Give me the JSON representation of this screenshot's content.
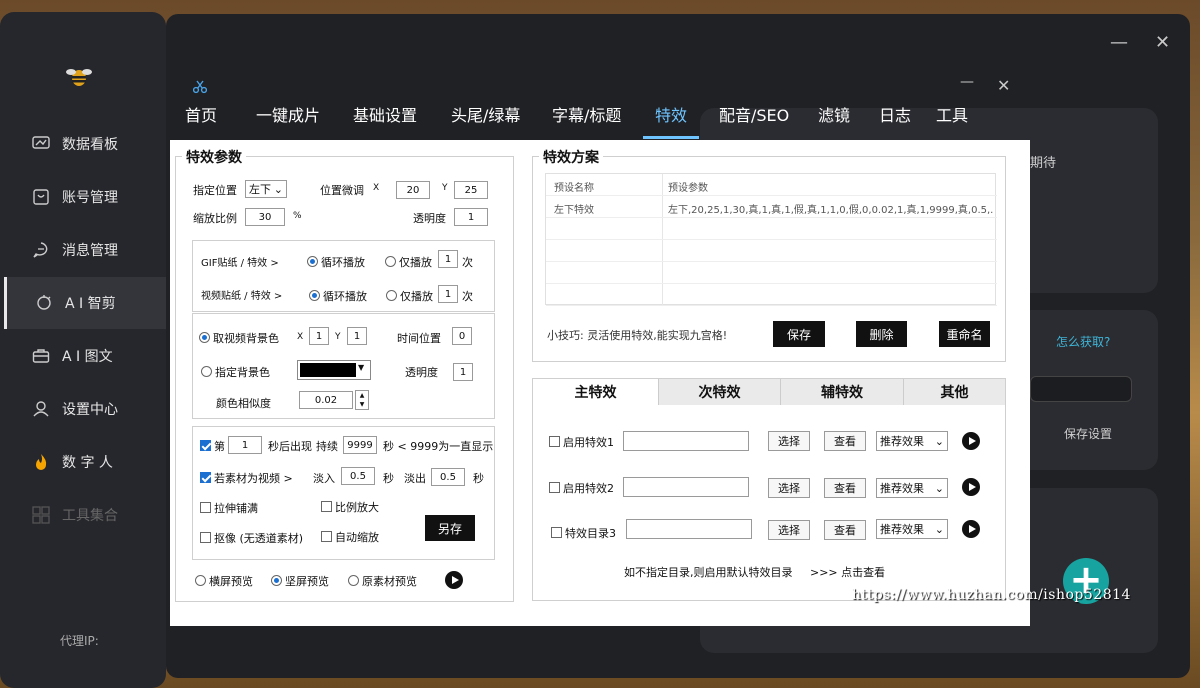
{
  "sidebar": {
    "items": [
      {
        "label": "数据看板",
        "icon": "dashboard-icon"
      },
      {
        "label": "账号管理",
        "icon": "account-icon"
      },
      {
        "label": "消息管理",
        "icon": "message-icon"
      },
      {
        "label": "A I 智剪",
        "icon": "ai-clip-icon"
      },
      {
        "label": "A I 图文",
        "icon": "briefcase-icon"
      },
      {
        "label": "设置中心",
        "icon": "settings-icon"
      },
      {
        "label": "数 字 人",
        "icon": "flame-icon"
      },
      {
        "label": "工具集合",
        "icon": "grid-icon"
      }
    ],
    "proxy_label": "代理IP:"
  },
  "background": {
    "wait_text": "期待",
    "how_get": "怎么获取?",
    "save_settings": "保存设置"
  },
  "watermark": "https://www.huzhan.com/ishop52814",
  "tabs": [
    "首页",
    "一键成片",
    "基础设置",
    "头尾/绿幕",
    "字幕/标题",
    "特效",
    "配音/SEO",
    "滤镜",
    "日志",
    "工具"
  ],
  "effect_params": {
    "title": "特效参数",
    "position_label": "指定位置",
    "position_value": "左下",
    "offset_label": "位置微调",
    "x_label": "X",
    "x_value": "20",
    "y_label": "Y",
    "y_value": "25",
    "scale_label": "缩放比例",
    "scale_value": "30",
    "percent": "%",
    "opacity_label": "透明度",
    "opacity_value": "1",
    "gif_label": "GIF贴纸 / 特效 >",
    "loop_label": "循环播放",
    "once_label": "仅播放",
    "gif_times": "1",
    "times_unit": "次",
    "video_label": "视频贴纸 / 特效 >",
    "video_times": "1",
    "take_bg_label": "取视频背景色",
    "bg_x": "1",
    "bg_y": "1",
    "time_pos_label": "时间位置",
    "time_pos_value": "0",
    "set_bg_label": "指定背景色",
    "bg_opacity_label": "透明度",
    "bg_opacity_value": "1",
    "similarity_label": "颜色相似度",
    "similarity_value": "0.02",
    "nth_label": "第",
    "nth_value": "1",
    "appear_label": "秒后出现",
    "duration_label": "持续",
    "duration_value": "9999",
    "duration_hint": "秒 < 9999为一直显示",
    "as_video_label": "若素材为视频 >",
    "fade_in_label": "淡入",
    "fade_in_value": "0.5",
    "sec": "秒",
    "fade_out_label": "淡出",
    "fade_out_value": "0.5",
    "stretch_label": "拉伸铺满",
    "ratio_label": "比例放大",
    "cutout_label": "抠像 (无透道素材)",
    "auto_scale_label": "自动缩放",
    "save_as": "另存",
    "landscape_label": "横屏预览",
    "portrait_label": "坚屏预览",
    "original_label": "原素材预览"
  },
  "effect_scheme": {
    "title": "特效方案",
    "col_name": "预设名称",
    "col_params": "预设参数",
    "rows": [
      {
        "name": "左下特效",
        "params": "左下,20,25,1,30,真,1,真,1,假,真,1,1,0,假,0,0.02,1,真,1,9999,真,0.5,..."
      }
    ],
    "tip": "小技巧: 灵活使用特效,能实现九宫格!",
    "save": "保存",
    "delete": "删除",
    "rename": "重命名"
  },
  "effect_tabs": [
    "主特效",
    "次特效",
    "辅特效",
    "其他"
  ],
  "effect_rows": [
    {
      "label": "启用特效1",
      "select": "选择",
      "view": "查看",
      "dropdown": "推荐效果"
    },
    {
      "label": "启用特效2",
      "select": "选择",
      "view": "查看",
      "dropdown": "推荐效果"
    },
    {
      "label": "特效目录3",
      "select": "选择",
      "view": "查看",
      "dropdown": "推荐效果"
    }
  ],
  "dir_hint": "如不指定目录,则启用默认特效目录",
  "dir_link": ">>> 点击查看",
  "colors": {
    "accent": "#6ec4ff",
    "panel": "#ffffff",
    "dark": "#202125",
    "fab": "#17a4a0"
  }
}
